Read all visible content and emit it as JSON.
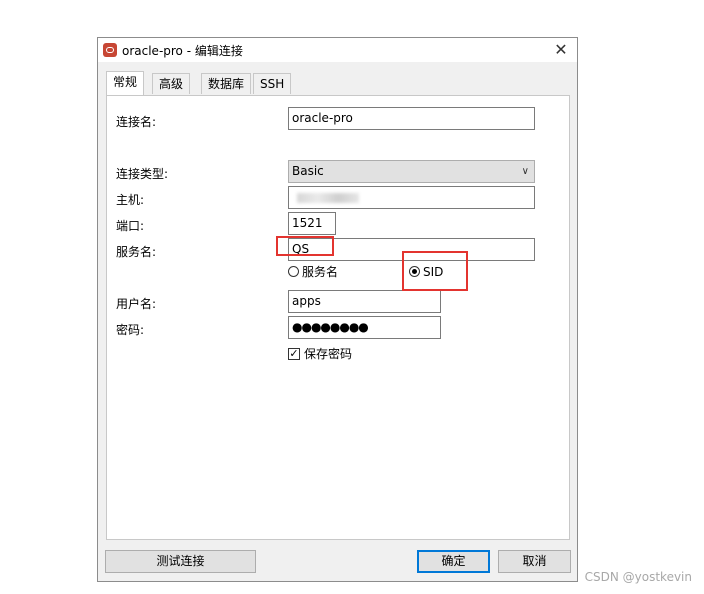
{
  "window": {
    "title": "oracle-pro - 编辑连接",
    "close_glyph": "✕"
  },
  "tabs": [
    {
      "label": "常规",
      "active": true
    },
    {
      "label": "高级",
      "active": false
    },
    {
      "label": "数据库",
      "active": false
    },
    {
      "label": "SSH",
      "active": false
    }
  ],
  "form": {
    "connection_name": {
      "label": "连接名:",
      "value": "oracle-pro"
    },
    "connection_type": {
      "label": "连接类型:",
      "value": "Basic"
    },
    "host": {
      "label": "主机:",
      "value": ""
    },
    "port": {
      "label": "端口:",
      "value": "1521"
    },
    "service_name": {
      "label": "服务名:",
      "value": "QS"
    },
    "service_mode": {
      "options": [
        {
          "label": "服务名",
          "checked": false
        },
        {
          "label": "SID",
          "checked": true
        }
      ]
    },
    "username": {
      "label": "用户名:",
      "value": "apps"
    },
    "password": {
      "label": "密码:",
      "value": "●●●●●●●●"
    },
    "save_password": {
      "label": "保存密码",
      "checked": true,
      "glyph": "✓"
    }
  },
  "buttons": {
    "test": "测试连接",
    "ok": "确定",
    "cancel": "取消"
  },
  "annotations": {
    "color": "#e3342f"
  },
  "watermark": "CSDN @yostkevin"
}
